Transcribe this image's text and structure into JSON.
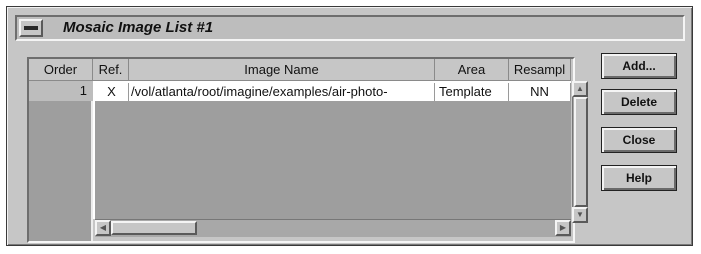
{
  "window": {
    "title": "Mosaic Image List #1"
  },
  "table": {
    "columns": [
      "Order",
      "Ref.",
      "Image Name",
      "Area",
      "Resampl"
    ],
    "rows": [
      {
        "order": "1",
        "ref": "X",
        "image_name": "/vol/atlanta/root/imagine/examples/air-photo-",
        "area": "Template",
        "resample": "NN"
      }
    ]
  },
  "buttons": {
    "add": "Add...",
    "delete": "Delete",
    "close": "Close",
    "help": "Help"
  },
  "icons": {
    "window_menu": "window-menu-icon",
    "scroll_up": "arrow-up-icon",
    "scroll_down": "arrow-down-icon",
    "scroll_left": "arrow-left-icon",
    "scroll_right": "arrow-right-icon"
  }
}
